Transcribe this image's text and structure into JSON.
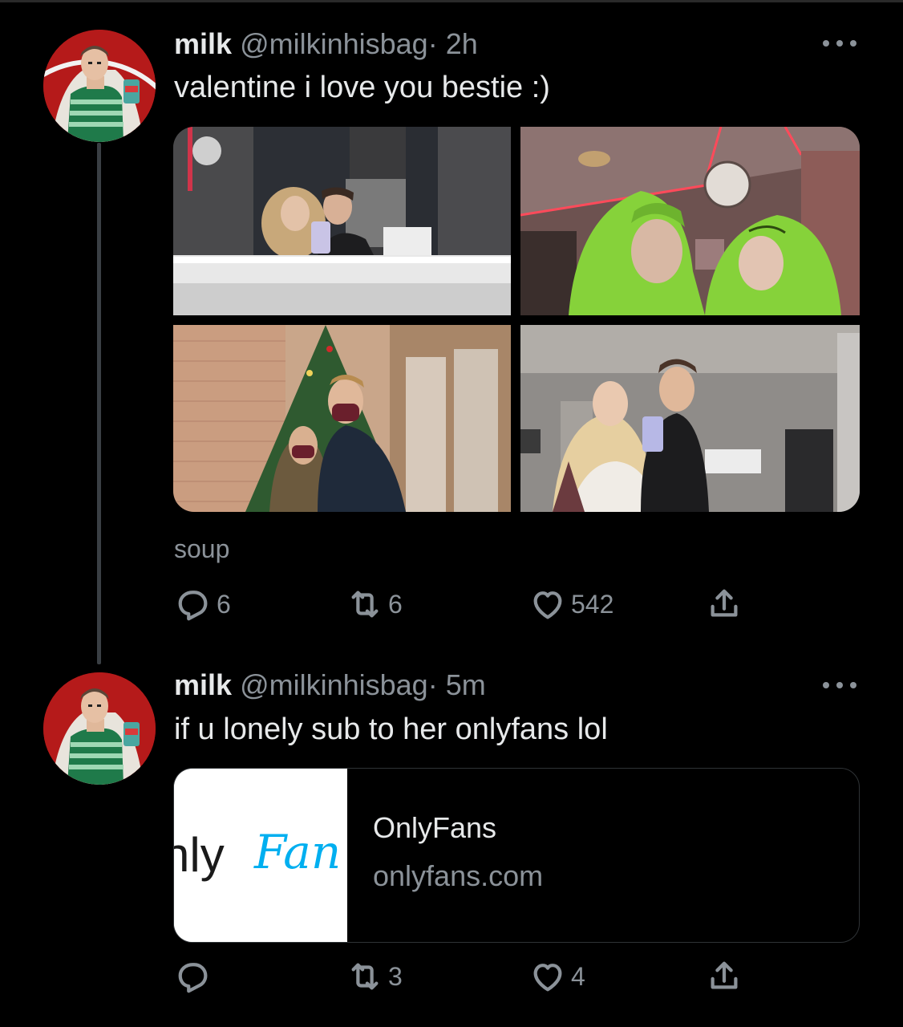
{
  "tweets": [
    {
      "name": "milk",
      "handle": "@milkinhisbag",
      "time_sep": "·",
      "time": "2h",
      "text": "valentine i love you bestie :)",
      "caption": "soup",
      "replies": "6",
      "retweets": "6",
      "likes": "542"
    },
    {
      "name": "milk",
      "handle": "@milkinhisbag",
      "time_sep": "·",
      "time": "5m",
      "text": "if u lonely sub to her onlyfans lol",
      "replies": "",
      "retweets": "3",
      "likes": "4",
      "card": {
        "logo_text_1": "nly",
        "logo_text_2": "Fan",
        "title": "OnlyFans",
        "domain": "onlyfans.com"
      }
    }
  ],
  "icons": {
    "reply": "reply-icon",
    "retweet": "retweet-icon",
    "like": "heart-icon",
    "share": "share-icon",
    "more": "more-icon"
  },
  "colors": {
    "background": "#000000",
    "text": "#e7e9ea",
    "secondary": "#8b9299",
    "border": "#2f3336",
    "onlyfans_blue": "#00aff0"
  }
}
